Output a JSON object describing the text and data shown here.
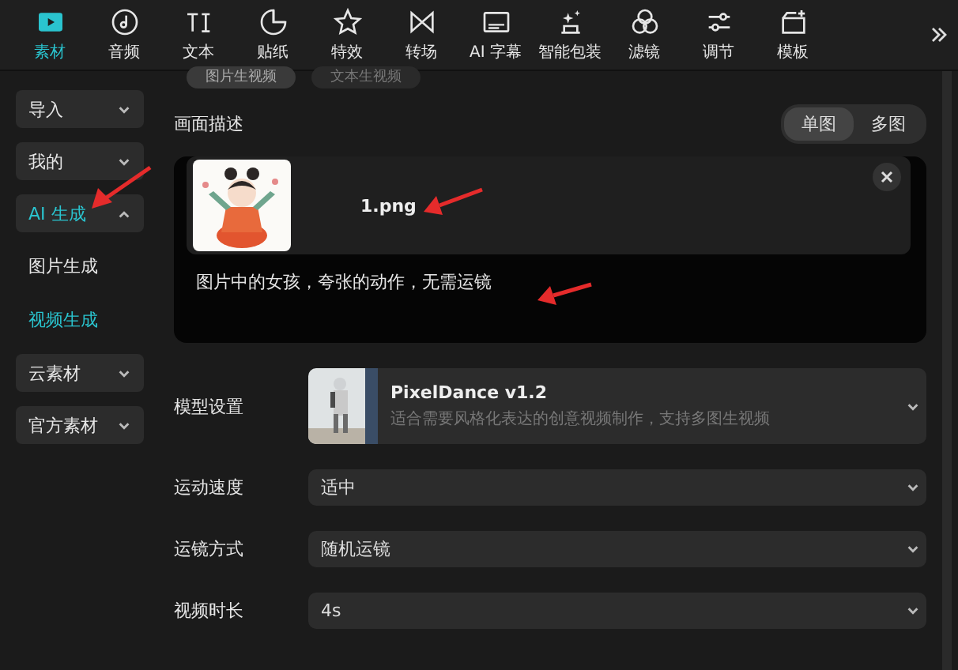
{
  "toolbar": [
    {
      "kind": "media",
      "label": "素材",
      "selected": true
    },
    {
      "kind": "audio",
      "label": "音频",
      "selected": false
    },
    {
      "kind": "text",
      "label": "文本",
      "selected": false
    },
    {
      "kind": "sticker",
      "label": "贴纸",
      "selected": false
    },
    {
      "kind": "effect",
      "label": "特效",
      "selected": false
    },
    {
      "kind": "transition",
      "label": "转场",
      "selected": false
    },
    {
      "kind": "caption",
      "label": "AI 字幕",
      "selected": false
    },
    {
      "kind": "package",
      "label": "智能包装",
      "selected": false
    },
    {
      "kind": "filter",
      "label": "滤镜",
      "selected": false
    },
    {
      "kind": "adjust",
      "label": "调节",
      "selected": false
    },
    {
      "kind": "template",
      "label": "模板",
      "selected": false
    }
  ],
  "sidebar": {
    "items": [
      {
        "label": "导入",
        "expanded": false
      },
      {
        "label": "我的",
        "expanded": false
      },
      {
        "label": "AI 生成",
        "expanded": true,
        "children": [
          {
            "label": "图片生成",
            "selected": false
          },
          {
            "label": "视频生成",
            "selected": true
          }
        ]
      },
      {
        "label": "云素材",
        "expanded": false
      },
      {
        "label": "官方素材",
        "expanded": false
      }
    ]
  },
  "mode_tabs": [
    {
      "label": "图片生视频",
      "selected": true
    },
    {
      "label": "文本生视频",
      "selected": false
    }
  ],
  "description": {
    "label": "画面描述",
    "view_toggle": [
      {
        "label": "单图",
        "selected": true
      },
      {
        "label": "多图",
        "selected": false
      }
    ],
    "file": {
      "name": "1.png"
    },
    "prompt": "图片中的女孩，夸张的动作，无需运镜"
  },
  "model": {
    "label": "模型设置",
    "name": "PixelDance v1.2",
    "detail": "适合需要风格化表达的创意视频制作，支持多图生视频"
  },
  "settings": [
    {
      "label": "运动速度",
      "value": "适中"
    },
    {
      "label": "运镜方式",
      "value": "随机运镜"
    },
    {
      "label": "视频时长",
      "value": "4s"
    }
  ]
}
